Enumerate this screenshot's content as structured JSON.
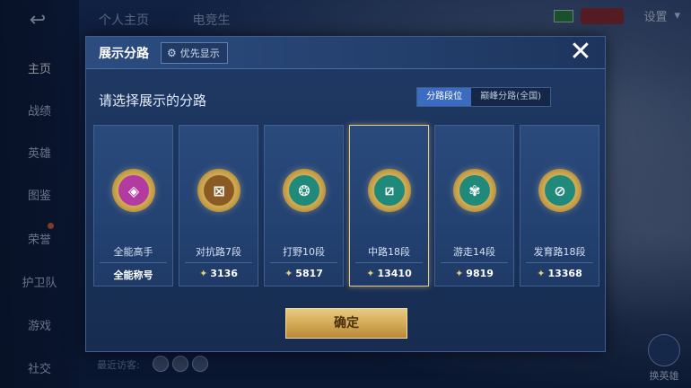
{
  "background": {
    "top_tabs": [
      "个人主页",
      "电竞生"
    ],
    "settings_label": "设置",
    "nav": [
      {
        "label": "主页",
        "active": true
      },
      {
        "label": "战绩",
        "active": false
      },
      {
        "label": "英雄",
        "active": false
      },
      {
        "label": "图鉴",
        "active": false
      },
      {
        "label": "荣誉",
        "active": false
      },
      {
        "label": "护卫队",
        "active": false
      },
      {
        "label": "游戏",
        "active": false
      },
      {
        "label": "社交",
        "active": false
      }
    ],
    "recent_visitors": "最近访客:",
    "side_button": "换英雄"
  },
  "modal": {
    "title": "展示分路",
    "priority_button": "优先显示",
    "close": "✕",
    "prompt": "请选择展示的分路",
    "segments": [
      "分路段位",
      "巅峰分路(全国)"
    ],
    "active_segment": 0,
    "cards": [
      {
        "name": "全能高手",
        "value": "全能称号",
        "show_arrow": false,
        "badge_color": "#b23aa0",
        "glyph": "◈",
        "selected": false
      },
      {
        "name": "对抗路7段",
        "value": "3136",
        "show_arrow": true,
        "badge_color": "#8a5a24",
        "glyph": "⊠",
        "selected": false
      },
      {
        "name": "打野10段",
        "value": "5817",
        "show_arrow": true,
        "badge_color": "#1f8a7a",
        "glyph": "❂",
        "selected": false
      },
      {
        "name": "中路18段",
        "value": "13410",
        "show_arrow": true,
        "badge_color": "#1f8a7a",
        "glyph": "⧄",
        "selected": true
      },
      {
        "name": "游走14段",
        "value": "9819",
        "show_arrow": true,
        "badge_color": "#1f8a7a",
        "glyph": "✾",
        "selected": false
      },
      {
        "name": "发育路18段",
        "value": "13368",
        "show_arrow": true,
        "badge_color": "#1f8a7a",
        "glyph": "⊘",
        "selected": false
      }
    ],
    "confirm": "确定"
  }
}
